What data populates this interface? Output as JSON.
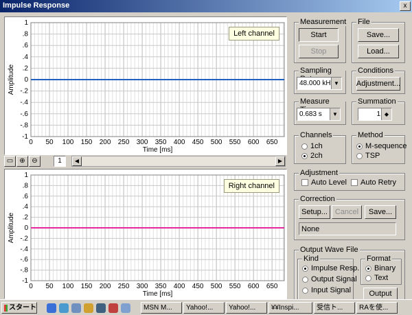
{
  "window": {
    "title": "Impulse Response",
    "close_label": "x"
  },
  "charts": [
    {
      "tag": "Left channel",
      "ylabel": "Amplitude",
      "xlabel": "Time [ms]",
      "color": "#1f5fbf",
      "chart_data": {
        "type": "line",
        "title": "",
        "xlabel": "Time [ms]",
        "ylabel": "Amplitude",
        "xlim": [
          0,
          683
        ],
        "ylim": [
          -1,
          1
        ],
        "series": [
          {
            "x": [
              0,
              683
            ],
            "y": [
              0,
              0
            ]
          }
        ]
      }
    },
    {
      "tag": "Right channel",
      "ylabel": "Amplitude",
      "xlabel": "Time [ms]",
      "color": "#e6279b",
      "chart_data": {
        "type": "line",
        "title": "",
        "xlabel": "Time [ms]",
        "ylabel": "Amplitude",
        "xlim": [
          0,
          683
        ],
        "ylim": [
          -1,
          1
        ],
        "series": [
          {
            "x": [
              0,
              683
            ],
            "y": [
              0,
              0
            ]
          }
        ]
      }
    }
  ],
  "axis": {
    "yticks": [
      "1",
      ".8",
      ".6",
      ".4",
      ".2",
      "0",
      "-.2",
      "-.4",
      "-.6",
      "-.8",
      "-1"
    ],
    "xticks": [
      "0",
      "50",
      "100",
      "150",
      "200",
      "250",
      "300",
      "350",
      "400",
      "450",
      "500",
      "550",
      "600",
      "650"
    ]
  },
  "plot_toolbar": {
    "page": "1",
    "left_arrow": "◀",
    "right_arrow": "▶"
  },
  "measurement": {
    "label": "Measurement",
    "start": "Start",
    "stop": "Stop"
  },
  "file": {
    "label": "File",
    "save": "Save...",
    "load": "Load..."
  },
  "sampling": {
    "label": "Sampling Rate",
    "value": "48.000 kHz"
  },
  "conditions": {
    "label": "Conditions",
    "adjustment": "Adjustment..."
  },
  "measure_time": {
    "label": "Measure Time",
    "value": "0.683 s"
  },
  "summation": {
    "label": "Summation",
    "value": "1"
  },
  "channels": {
    "label": "Channels",
    "options": [
      "1ch",
      "2ch"
    ],
    "selected": "2ch"
  },
  "method": {
    "label": "Method",
    "options": [
      "M-sequence",
      "TSP"
    ],
    "selected": "M-sequence"
  },
  "adjustment": {
    "label": "Adjustment",
    "auto_level": "Auto Level",
    "auto_retry": "Auto Retry"
  },
  "correction": {
    "label": "Correction",
    "setup": "Setup...",
    "cancel": "Cancel",
    "save": "Save...",
    "value": "None"
  },
  "output": {
    "label": "Output Wave File",
    "kind_label": "Kind",
    "kinds": [
      "Impulse Resp.",
      "Output Signal",
      "Input Signal"
    ],
    "kind_selected": "Impulse Resp.",
    "format_label": "Format",
    "formats": [
      "Binary",
      "Text"
    ],
    "format_selected": "Binary",
    "output_button": "Output"
  },
  "taskbar": {
    "start": "スタート",
    "items": [
      "MSN M...",
      "Yahoo!...",
      "Yahoo!...",
      "¥¥Inspi...",
      "受信ト...",
      "RAを使..."
    ]
  }
}
